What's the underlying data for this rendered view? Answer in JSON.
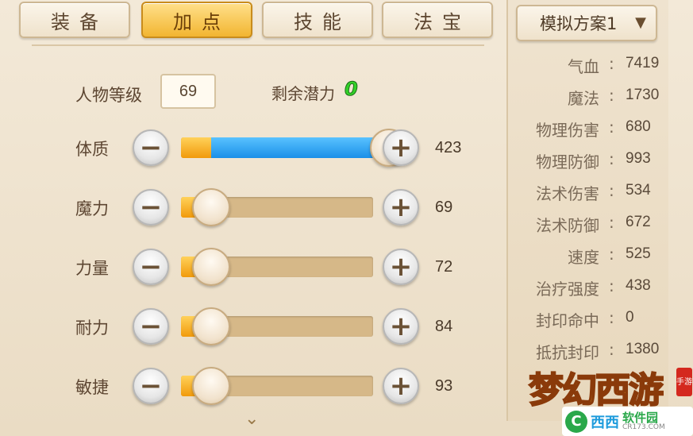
{
  "tabs": [
    {
      "label": "装备",
      "active": false
    },
    {
      "label": "加点",
      "active": true
    },
    {
      "label": "技能",
      "active": false
    },
    {
      "label": "法宝",
      "active": false
    }
  ],
  "level": {
    "label": "人物等级",
    "value": "69"
  },
  "potential": {
    "label": "剩余潜力",
    "value": "0"
  },
  "attributes": [
    {
      "label": "体质",
      "value": "423",
      "fill": 1.0
    },
    {
      "label": "魔力",
      "value": "69",
      "fill": 0.0
    },
    {
      "label": "力量",
      "value": "72",
      "fill": 0.0
    },
    {
      "label": "耐力",
      "value": "84",
      "fill": 0.0
    },
    {
      "label": "敏捷",
      "value": "93",
      "fill": 0.0
    }
  ],
  "plan": {
    "label": "模拟方案1"
  },
  "stats": [
    {
      "label": "气血",
      "value": "7419"
    },
    {
      "label": "魔法",
      "value": "1730"
    },
    {
      "label": "物理伤害",
      "value": "680"
    },
    {
      "label": "物理防御",
      "value": "993"
    },
    {
      "label": "法术伤害",
      "value": "534"
    },
    {
      "label": "法术防御",
      "value": "672"
    },
    {
      "label": "速度",
      "value": "525"
    },
    {
      "label": "治疗强度",
      "value": "438"
    },
    {
      "label": "封印命中",
      "value": "0"
    },
    {
      "label": "抵抗封印",
      "value": "1380"
    }
  ],
  "logo": {
    "text": "梦幻西游",
    "badge": "手游"
  },
  "watermark": {
    "brand": "西西",
    "site": "软件园",
    "domain": "CR173.COM"
  },
  "icons": {
    "minus": "minus-icon",
    "plus": "plus-icon",
    "chevron": "chevron-down-icon"
  }
}
